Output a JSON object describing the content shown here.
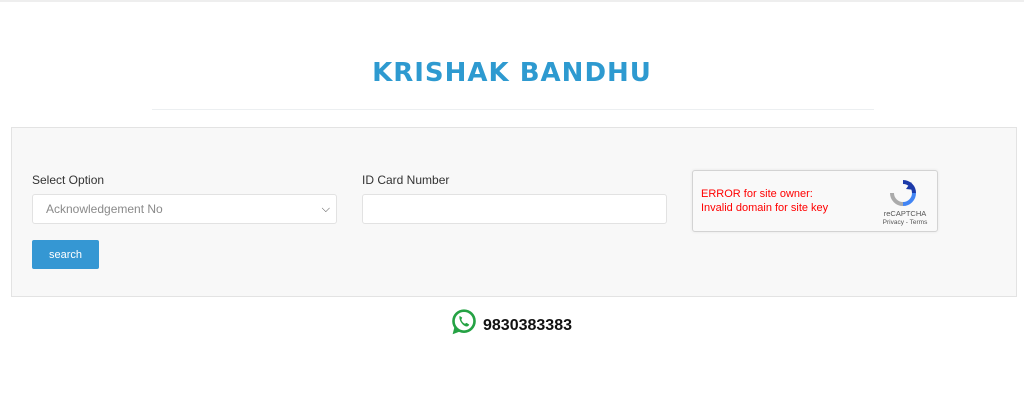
{
  "header": {
    "title": "KRISHAK BANDHU"
  },
  "form": {
    "select_label": "Select Option",
    "select_value": "Acknowledgement No",
    "id_label": "ID Card Number",
    "id_value": "",
    "search_label": "search"
  },
  "captcha": {
    "error_line1": "ERROR for site owner:",
    "error_line2": "Invalid domain for site key",
    "brand": "reCAPTCHA",
    "links": "Privacy - Terms"
  },
  "contact": {
    "phone": "9830383383",
    "icon": "whatsapp-icon"
  },
  "colors": {
    "accent": "#2e9ad0",
    "button": "#3597d3",
    "error": "#ff0000",
    "whatsapp": "#25a244"
  }
}
